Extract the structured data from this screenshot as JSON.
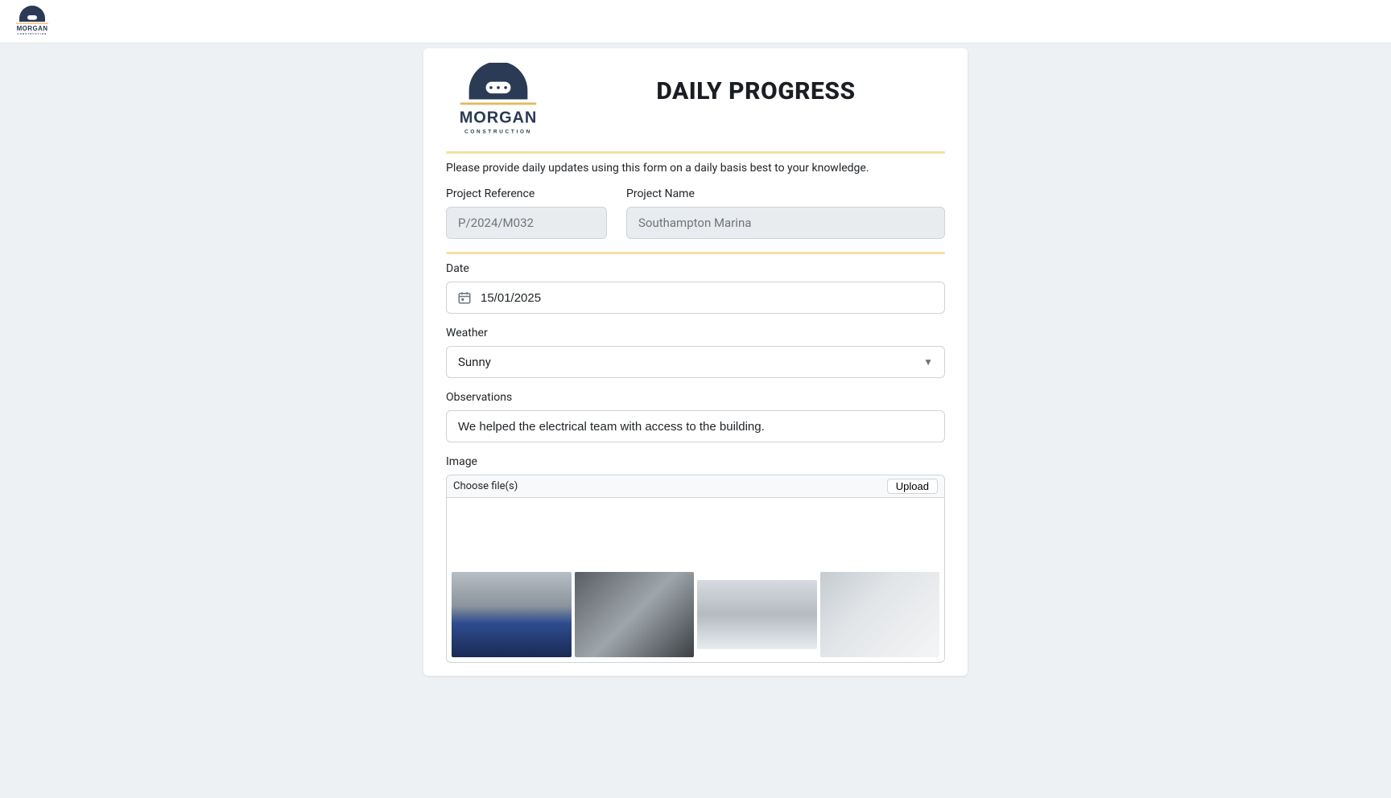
{
  "brand": {
    "name": "MORGAN",
    "sub": "CONSTRUCTION"
  },
  "form": {
    "title": "DAILY PROGRESS",
    "intro": "Please provide daily updates using this form on a daily basis best to your knowledge.",
    "project_ref_label": "Project Reference",
    "project_ref_value": "P/2024/M032",
    "project_name_label": "Project Name",
    "project_name_value": "Southampton Marina",
    "date_label": "Date",
    "date_value": "15/01/2025",
    "weather_label": "Weather",
    "weather_value": "Sunny",
    "observations_label": "Observations",
    "observations_value": "We helped the electrical team with access to the building.",
    "image_label": "Image",
    "choose_files_label": "Choose file(s)",
    "upload_label": "Upload"
  }
}
